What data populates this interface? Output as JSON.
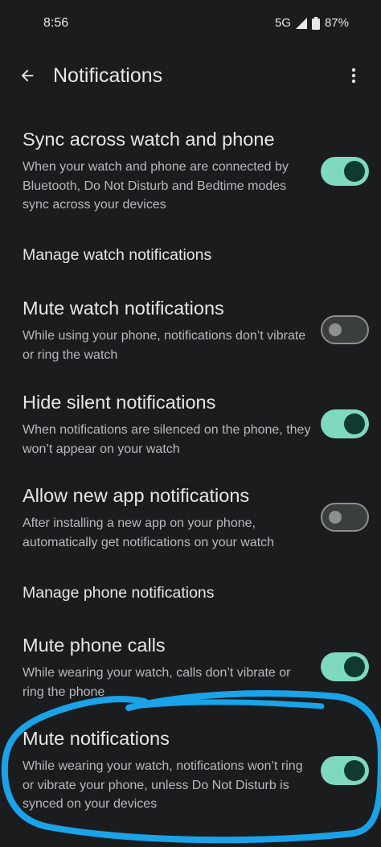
{
  "status_bar": {
    "time": "8:56",
    "network": "5G",
    "battery": "87%"
  },
  "app_bar": {
    "title": "Notifications",
    "back_icon": "arrow-left-icon",
    "menu_icon": "more-vert-icon"
  },
  "settings": {
    "sync": {
      "title": "Sync across watch and phone",
      "description": "When your watch and phone are connected by Bluetooth, Do Not Disturb and Bedtime modes sync across your devices",
      "enabled": true
    },
    "watch_header": "Manage watch notifications",
    "mute_watch": {
      "title": "Mute watch notifications",
      "description": "While using your phone, notifications don’t vibrate or ring the watch",
      "enabled": false
    },
    "hide_silent": {
      "title": "Hide silent notifications",
      "description": "When notifications are silenced on the phone, they won’t appear on your watch",
      "enabled": true
    },
    "allow_new_app": {
      "title": "Allow new app notifications",
      "description": "After installing a new app on your phone, automatically get notifications on your watch",
      "enabled": false
    },
    "phone_header": "Manage phone notifications",
    "mute_calls": {
      "title": "Mute phone calls",
      "description": "While wearing your watch, calls don’t vibrate or ring the phone",
      "enabled": true
    },
    "mute_notifications": {
      "title": "Mute notifications",
      "description": "While wearing your watch, notifications won’t ring or vibrate your phone, unless Do Not Disturb is synced on your devices",
      "enabled": true
    }
  },
  "colors": {
    "background": "#1b1c1e",
    "switch_on_track": "#7fd8c0",
    "switch_on_knob": "#103a30",
    "switch_off_track": "#3a3e3d",
    "switch_off_outline": "#8c9190",
    "annotation": "#1aa3e8"
  }
}
